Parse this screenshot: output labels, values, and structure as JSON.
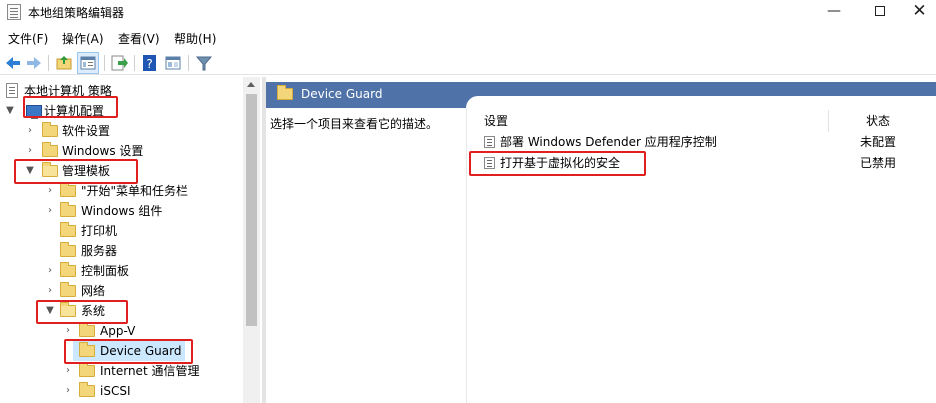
{
  "window": {
    "title": "本地组策略编辑器",
    "minimize": "—",
    "close": "✕"
  },
  "menu": [
    "文件(F)",
    "操作(A)",
    "查看(V)",
    "帮助(H)"
  ],
  "toolbar": {
    "icons": [
      "back-arrow-icon",
      "forward-arrow-icon",
      "up-folder-icon",
      "show-tree-icon",
      "export-list-icon",
      "help-icon",
      "properties-icon",
      "filter-icon"
    ]
  },
  "tree": {
    "root": "本地计算机 策略",
    "computer_config": "计算机配置",
    "software_settings": "软件设置",
    "windows_settings": "Windows 设置",
    "admin_templates": "管理模板",
    "start_menu": "\"开始\"菜单和任务栏",
    "windows_components": "Windows 组件",
    "printers": "打印机",
    "server": "服务器",
    "control_panel": "控制面板",
    "network": "网络",
    "system": "系统",
    "appv": "App-V",
    "device_guard": "Device Guard",
    "internet_comm": "Internet 通信管理",
    "iscsi": "iSCSI"
  },
  "details": {
    "header_title": "Device Guard",
    "description": "选择一个项目来查看它的描述。",
    "col_setting": "设置",
    "col_state": "状态",
    "policies": [
      {
        "name": "部署 Windows Defender 应用程序控制",
        "state": "未配置"
      },
      {
        "name": "打开基于虚拟化的安全",
        "state": "已禁用"
      }
    ]
  },
  "colors": {
    "header_band": "#4f72a8",
    "highlight_box": "#e0201e",
    "selection": "#cce8ff",
    "folder": "#f3d57a"
  }
}
